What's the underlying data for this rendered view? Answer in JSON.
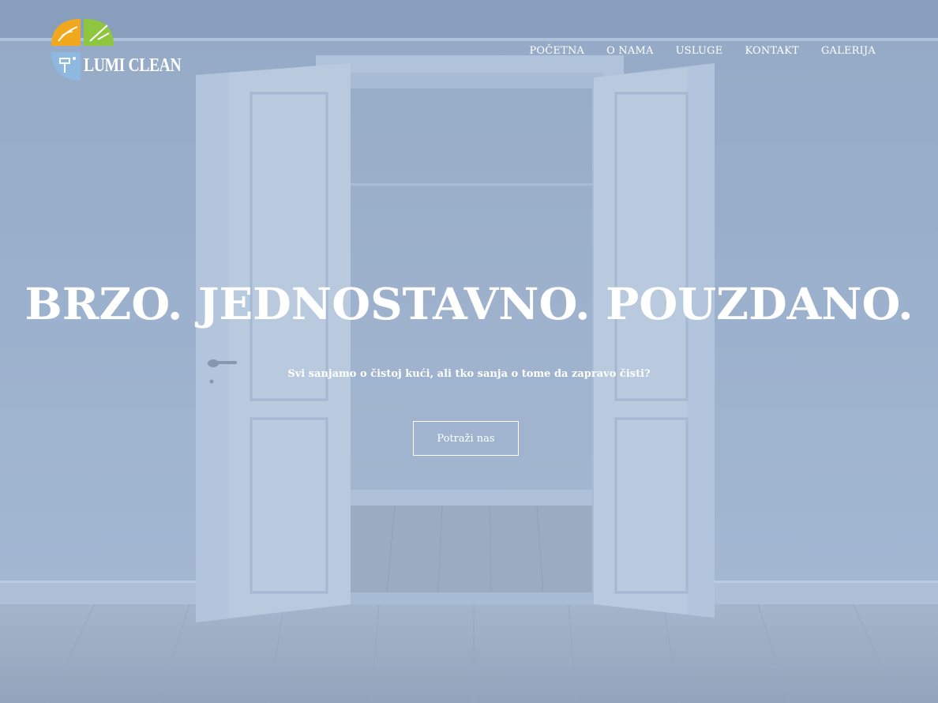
{
  "brand": {
    "name": "LUMI CLEAN",
    "colors": {
      "orange": "#f2a81d",
      "green": "#8fc63f",
      "blue": "#8fb8e0"
    }
  },
  "nav": {
    "items": [
      {
        "label": "POČETNA"
      },
      {
        "label": "O NAMA"
      },
      {
        "label": "USLUGE"
      },
      {
        "label": "KONTAKT"
      },
      {
        "label": "GALERIJA"
      }
    ]
  },
  "hero": {
    "headline": "BRZO. JEDNOSTAVNO. POUZDANO.",
    "subtitle": "Svi sanjamo o čistoj kući, ali tko sanja o tome da zapravo čisti?",
    "cta_label": "Potraži nas"
  },
  "colors": {
    "overlay": "#7896c3",
    "text": "#ffffff"
  }
}
